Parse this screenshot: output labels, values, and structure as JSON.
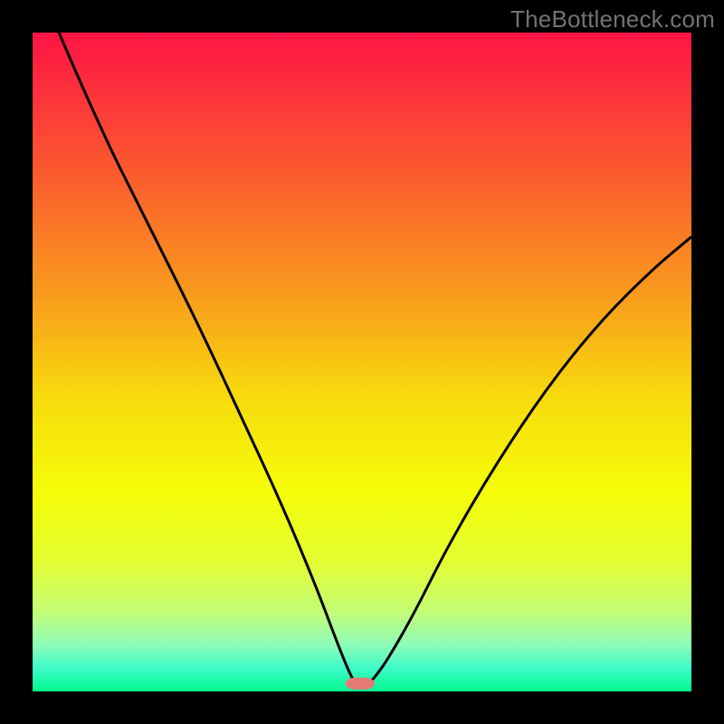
{
  "watermark": "TheBottleneck.com",
  "chart_data": {
    "type": "line",
    "xlabel": "",
    "ylabel": "",
    "xlim": [
      0,
      100
    ],
    "ylim": [
      0,
      100
    ],
    "title": "",
    "background": {
      "type": "vertical-gradient",
      "stops": [
        {
          "offset": 0,
          "color": "#fe1445"
        },
        {
          "offset": 20,
          "color": "#fb5630"
        },
        {
          "offset": 40,
          "color": "#f99c1d"
        },
        {
          "offset": 55,
          "color": "#f7da0d"
        },
        {
          "offset": 70,
          "color": "#f5fd08"
        },
        {
          "offset": 80,
          "color": "#e4fd31"
        },
        {
          "offset": 88,
          "color": "#c3fd76"
        },
        {
          "offset": 93,
          "color": "#8dfcb8"
        },
        {
          "offset": 96.5,
          "color": "#3cfbc8"
        },
        {
          "offset": 100,
          "color": "#02fb8e"
        }
      ]
    },
    "curve": [
      {
        "x": 4,
        "y": 100
      },
      {
        "x": 10,
        "y": 86
      },
      {
        "x": 17,
        "y": 72
      },
      {
        "x": 25,
        "y": 56
      },
      {
        "x": 32,
        "y": 41
      },
      {
        "x": 38,
        "y": 28
      },
      {
        "x": 43,
        "y": 16
      },
      {
        "x": 46,
        "y": 8
      },
      {
        "x": 48,
        "y": 3
      },
      {
        "x": 49,
        "y": 1.2
      },
      {
        "x": 50.5,
        "y": 1.4
      },
      {
        "x": 51,
        "y": 1.2
      },
      {
        "x": 52,
        "y": 2.2
      },
      {
        "x": 54,
        "y": 5
      },
      {
        "x": 58,
        "y": 12
      },
      {
        "x": 63,
        "y": 22
      },
      {
        "x": 70,
        "y": 34
      },
      {
        "x": 78,
        "y": 46
      },
      {
        "x": 86,
        "y": 56
      },
      {
        "x": 94,
        "y": 64
      },
      {
        "x": 100,
        "y": 69
      }
    ],
    "marker": {
      "x_center": 49.7,
      "x_halfwidth": 2.2,
      "y": 1.2,
      "color": "#e77975",
      "rx": 1.4
    },
    "curve_stroke": "#000000",
    "curve_width": 3
  }
}
